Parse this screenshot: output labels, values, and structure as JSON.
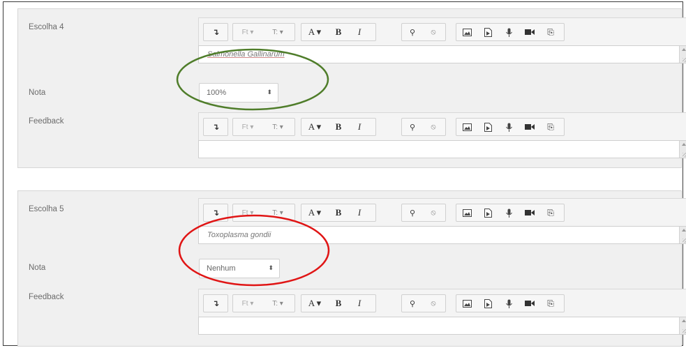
{
  "toolbar": {
    "icons": [
      "indent-icon",
      "paragraph-style-icon",
      "font-size-icon",
      "font-color-icon",
      "bold-icon",
      "italic-icon",
      "link-icon",
      "unlink-icon",
      "image-icon",
      "media-icon",
      "microphone-icon",
      "video-icon",
      "manage-files-icon"
    ],
    "indent": "↴",
    "para": "Ft ▾",
    "fsize": "T: ▾",
    "color": "A ▾",
    "bold": "B",
    "italic": "I",
    "link": "⚲",
    "unlink": "⦸",
    "mic": "🎙",
    "files": "⎘"
  },
  "choice4": {
    "label": "Escolha 4",
    "answer": "Salmonella Gallinarum",
    "grade_label": "Nota",
    "grade_value": "100%",
    "feedback_label": "Feedback",
    "feedback_value": ""
  },
  "choice5": {
    "label": "Escolha 5",
    "answer": "Toxoplasma gondii",
    "grade_label": "Nota",
    "grade_value": "Nenhum",
    "feedback_label": "Feedback",
    "feedback_value": ""
  },
  "colors": {
    "green_ellipse": "#4f7d2a",
    "red_ellipse": "#e01515",
    "block_bg": "#f0f0f0"
  }
}
